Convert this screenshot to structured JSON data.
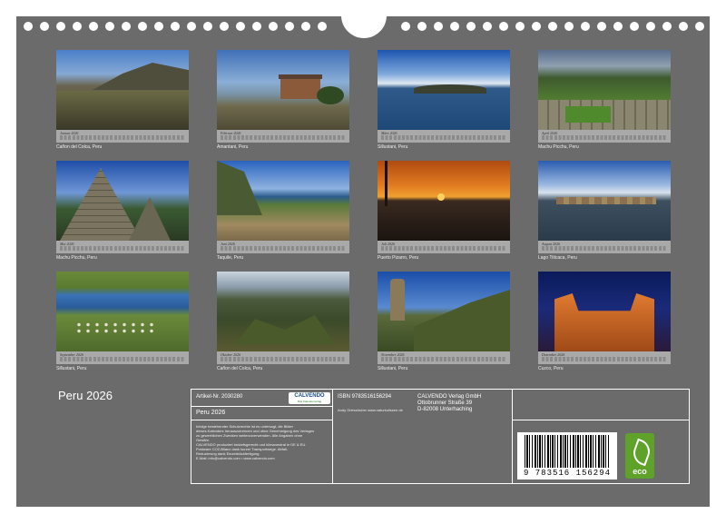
{
  "title": "Peru 2026",
  "months": [
    {
      "month": "Januar 2026",
      "caption": "Cañon del Colca, Peru"
    },
    {
      "month": "Februar 2026",
      "caption": "Amantani, Peru"
    },
    {
      "month": "März 2026",
      "caption": "Sillustani, Peru"
    },
    {
      "month": "April 2026",
      "caption": "Machu Picchu, Peru"
    },
    {
      "month": "Mai 2026",
      "caption": "Machu Picchu, Peru"
    },
    {
      "month": "Juni 2026",
      "caption": "Taquile, Peru"
    },
    {
      "month": "Juli 2026",
      "caption": "Puerto Pizarro, Peru"
    },
    {
      "month": "August 2026",
      "caption": "Lago Titicaca, Peru"
    },
    {
      "month": "September 2026",
      "caption": "Sillustani, Peru"
    },
    {
      "month": "Oktober 2026",
      "caption": "Cañon del Colca, Peru"
    },
    {
      "month": "November 2026",
      "caption": "Sillustani, Peru"
    },
    {
      "month": "Dezember 2026",
      "caption": "Cuzco, Peru"
    }
  ],
  "info": {
    "article": "Artikel-Nr. 2030280",
    "product_title": "Peru 2026",
    "logo": "CALVENDO",
    "logo_sub": "Das Kalenderverlag",
    "legal_lines": [
      "Infolge bestehender Schutzrechte ist es untersagt, die Bilder",
      "dieses Kalenders herauszutrennen und ohne Genehmigung des Verlages",
      "zu gewerblichen Zwecken weiterzuverwenden. Alle Angaben ohne",
      "Gewähr.",
      "CALVENDO produziert bedarfsgerecht und klimaneutral in DE & EU.",
      "Postware CO2-Bilanz dank kurzer Transportwege. Abfall-",
      "Reduzierung dank Einzelstückfertigung.",
      "E-Mail: info@calvendo.com • www.calvendo.com"
    ],
    "isbn": "ISBN 9783516156294",
    "author": "Andy Griesshuber www.naturkulissen.de",
    "publisher_lines": [
      "CALVENDO Verlag GmbH",
      "Ottobrunner Straße 39",
      "D-82008 Unterhaching"
    ],
    "barcode_number": "9 783516 156294",
    "eco_label": "eco"
  }
}
